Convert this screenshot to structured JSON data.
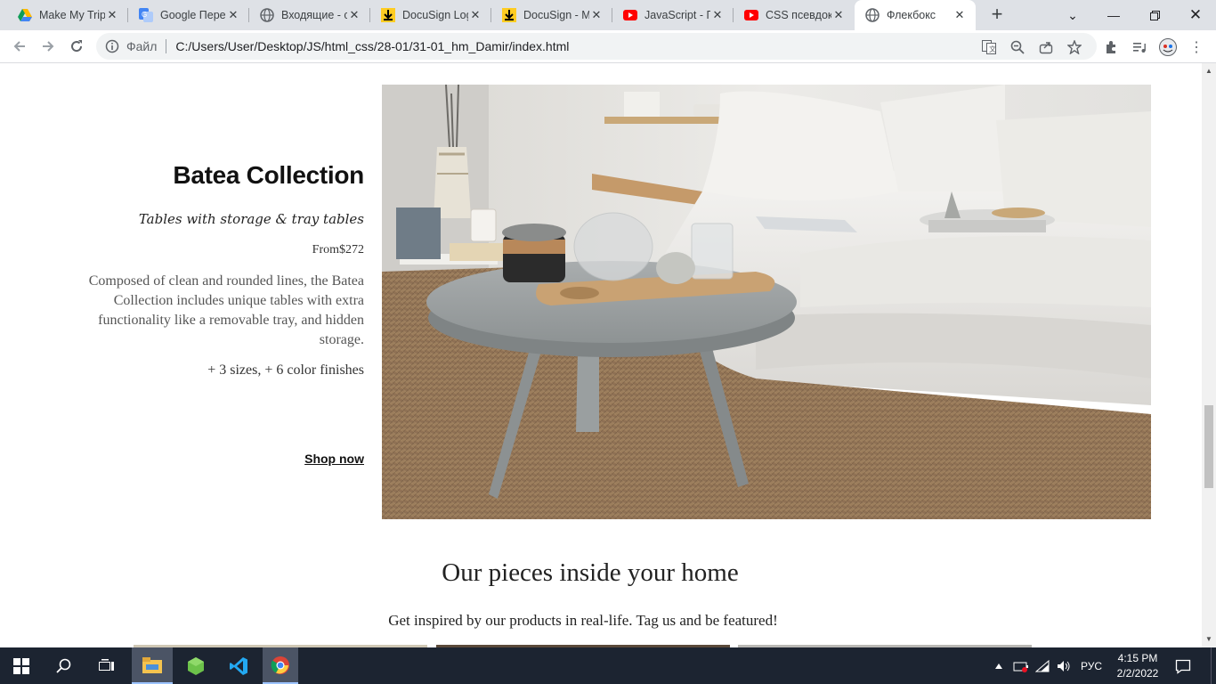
{
  "browser": {
    "tabs": [
      {
        "title": "Make My Trip",
        "icon": "google-drive-icon"
      },
      {
        "title": "Google Переводчик",
        "icon": "google-translate-icon"
      },
      {
        "title": "Входящие - chessmasterproject",
        "icon": "globe-icon"
      },
      {
        "title": "DocuSign Login",
        "icon": "docusign-icon"
      },
      {
        "title": "DocuSign - Manage",
        "icon": "docusign-icon"
      },
      {
        "title": "JavaScript - Псевдоклассы",
        "icon": "youtube-icon"
      },
      {
        "title": "CSS псевдоклассы",
        "icon": "youtube-icon"
      },
      {
        "title": "Флекбокс",
        "icon": "globe-icon"
      }
    ],
    "active_tab_index": 7,
    "address": {
      "scheme_label": "Файл",
      "url": "C:/Users/User/Desktop/JS/html_css/28-01/31-01_hm_Damir/index.html"
    }
  },
  "page": {
    "collection": {
      "title": "Batea Collection",
      "subtitle": "Tables with storage & tray tables",
      "price": "From$272",
      "description": "Composed of clean and rounded lines, the Batea Collection includes unique tables with extra functionality like a removable tray, and hidden storage.",
      "variants": "+ 3 sizes, + 6 color finishes",
      "cta": "Shop now"
    },
    "inspiration": {
      "title": "Our pieces inside your home",
      "subtitle": "Get inspired by our products in real-life. Tag us and be featured!"
    }
  },
  "taskbar": {
    "language": "РУС",
    "time": "4:15 PM",
    "date": "2/2/2022"
  }
}
